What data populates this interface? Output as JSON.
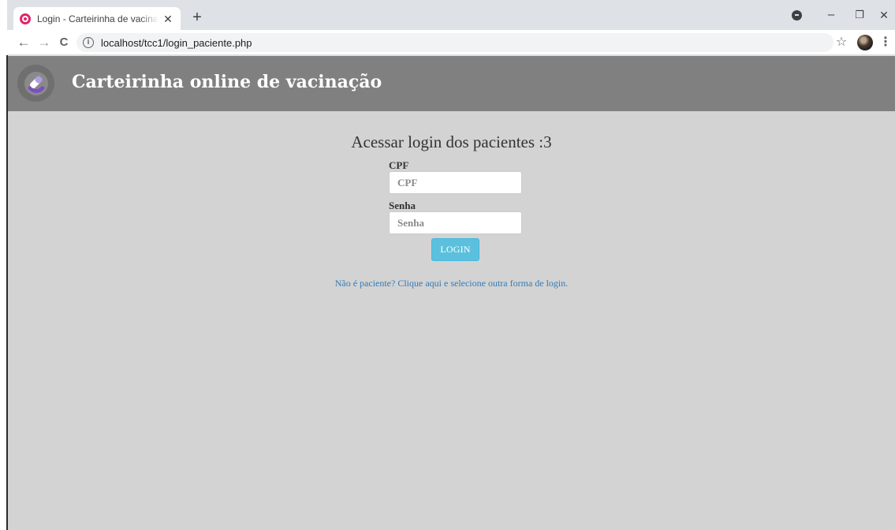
{
  "browser": {
    "tab_title": "Login - Carteirinha de vacinação",
    "tab_close": "✕",
    "new_tab": "+",
    "url": "localhost/tcc1/login_paciente.php",
    "icons": [
      "favicon-icon",
      "close-icon",
      "plus-icon",
      "back-arrow-icon",
      "forward-arrow-icon",
      "reload-icon",
      "info-icon",
      "star-icon",
      "profile-icon",
      "menu-icon",
      "minimize-icon",
      "restore-icon",
      "window-close-icon"
    ],
    "controls": {
      "back": "←",
      "forward": "→",
      "reload": "C",
      "info": "i",
      "star": "☆",
      "menu": "⋮",
      "minimize": "–",
      "restore": "❐",
      "close": "✕"
    }
  },
  "header": {
    "title": "Carteirinha online de vacinação"
  },
  "login": {
    "heading": "Acessar login dos pacientes :3",
    "cpf_label": "CPF",
    "cpf_placeholder": "CPF",
    "cpf_value": "",
    "senha_label": "Senha",
    "senha_placeholder": "Senha",
    "senha_value": "",
    "button_label": "LOGIN",
    "alt_link": "Não é paciente? Clique aqui e selecione outra forma de login."
  },
  "colors": {
    "header_bg": "#808080",
    "page_bg": "#d3d3d3",
    "button_bg": "#5bc0de",
    "link": "#337ab7",
    "favicon": "#e0266b",
    "logo_accent": "#7a4fc4"
  }
}
